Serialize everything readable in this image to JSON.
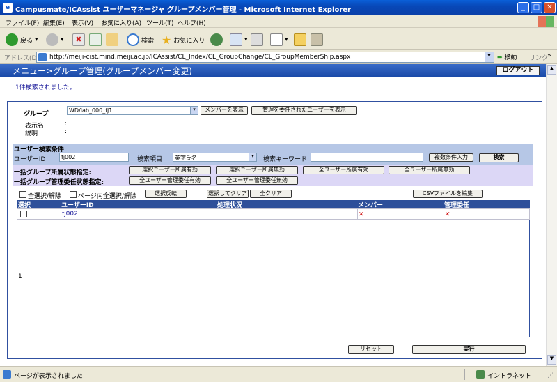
{
  "window": {
    "title": "Campusmate/ICAssist ユーザーマネージャ グループメンバー管理 - Microsoft Internet Explorer",
    "min": "_",
    "max": "□",
    "close": "✕"
  },
  "menubar": [
    "ファイル(F)",
    "編集(E)",
    "表示(V)",
    "お気に入り(A)",
    "ツール(T)",
    "ヘルプ(H)"
  ],
  "toolbar": {
    "back": "戻る",
    "search": "検索",
    "favorites": "お気に入り"
  },
  "address": {
    "label": "アドレス(D)",
    "url": "http://meiji-cist.mind.meiji.ac.jp/ICAssist/CL_Index/CL_GroupChange/CL_GroupMemberShip.aspx",
    "go": "移動",
    "links": "リンク"
  },
  "header": {
    "title": "メニュー>グループ管理(グループメンバー変更)",
    "logout": "ログアウト"
  },
  "message": "1件検索されました。",
  "group": {
    "label": "グループ",
    "selected": "WD/lab_000_fj1",
    "show_members": "メンバーを表示",
    "show_delegated": "管理を委任されたユーザーを表示",
    "display_name_label": "表示名",
    "description_label": "説明",
    "colon": ":"
  },
  "search": {
    "section_title": "ユーザー検索条件",
    "user_id_label": "ユーザーID",
    "user_id_value": "fj002",
    "field_label": "検索項目",
    "field_value": "英字氏名",
    "keyword_label": "検索キーワード",
    "keyword_value": "",
    "multi_condition": "複数条件入力",
    "search_button": "検索"
  },
  "bulk": {
    "membership_label": "一括グループ所属状態指定:",
    "delegate_label": "一括グループ管理委任状態指定:",
    "btn_sel_member_on": "選択ユーザー所属有効",
    "btn_sel_member_off": "選択ユーザー所属無効",
    "btn_all_member_on": "全ユーザー所属有効",
    "btn_all_member_off": "全ユーザー所属無効",
    "btn_all_delegate_on": "全ユーザー管理委任有効",
    "btn_all_delegate_off": "全ユーザー管理委任無効"
  },
  "list_controls": {
    "select_all": "全選択/解除",
    "page_select_all": "ページ内全選択/解除",
    "invert": "選択反転",
    "clear_selected": "選択してクリア",
    "clear_all": "全クリア",
    "csv_edit": "CSVファイルを編集"
  },
  "grid": {
    "headers": [
      "選択",
      "ユーザーID",
      "処理状況",
      "メンバー",
      "管理委任"
    ],
    "rows": [
      {
        "user_id": "fj002",
        "status": "",
        "member": "✕",
        "delegate": "✕"
      }
    ],
    "page_number": "1"
  },
  "footer": {
    "reset": "リセット",
    "execute": "実行"
  },
  "statusbar": {
    "text": "ページが表示されました",
    "zone": "イントラネット"
  }
}
